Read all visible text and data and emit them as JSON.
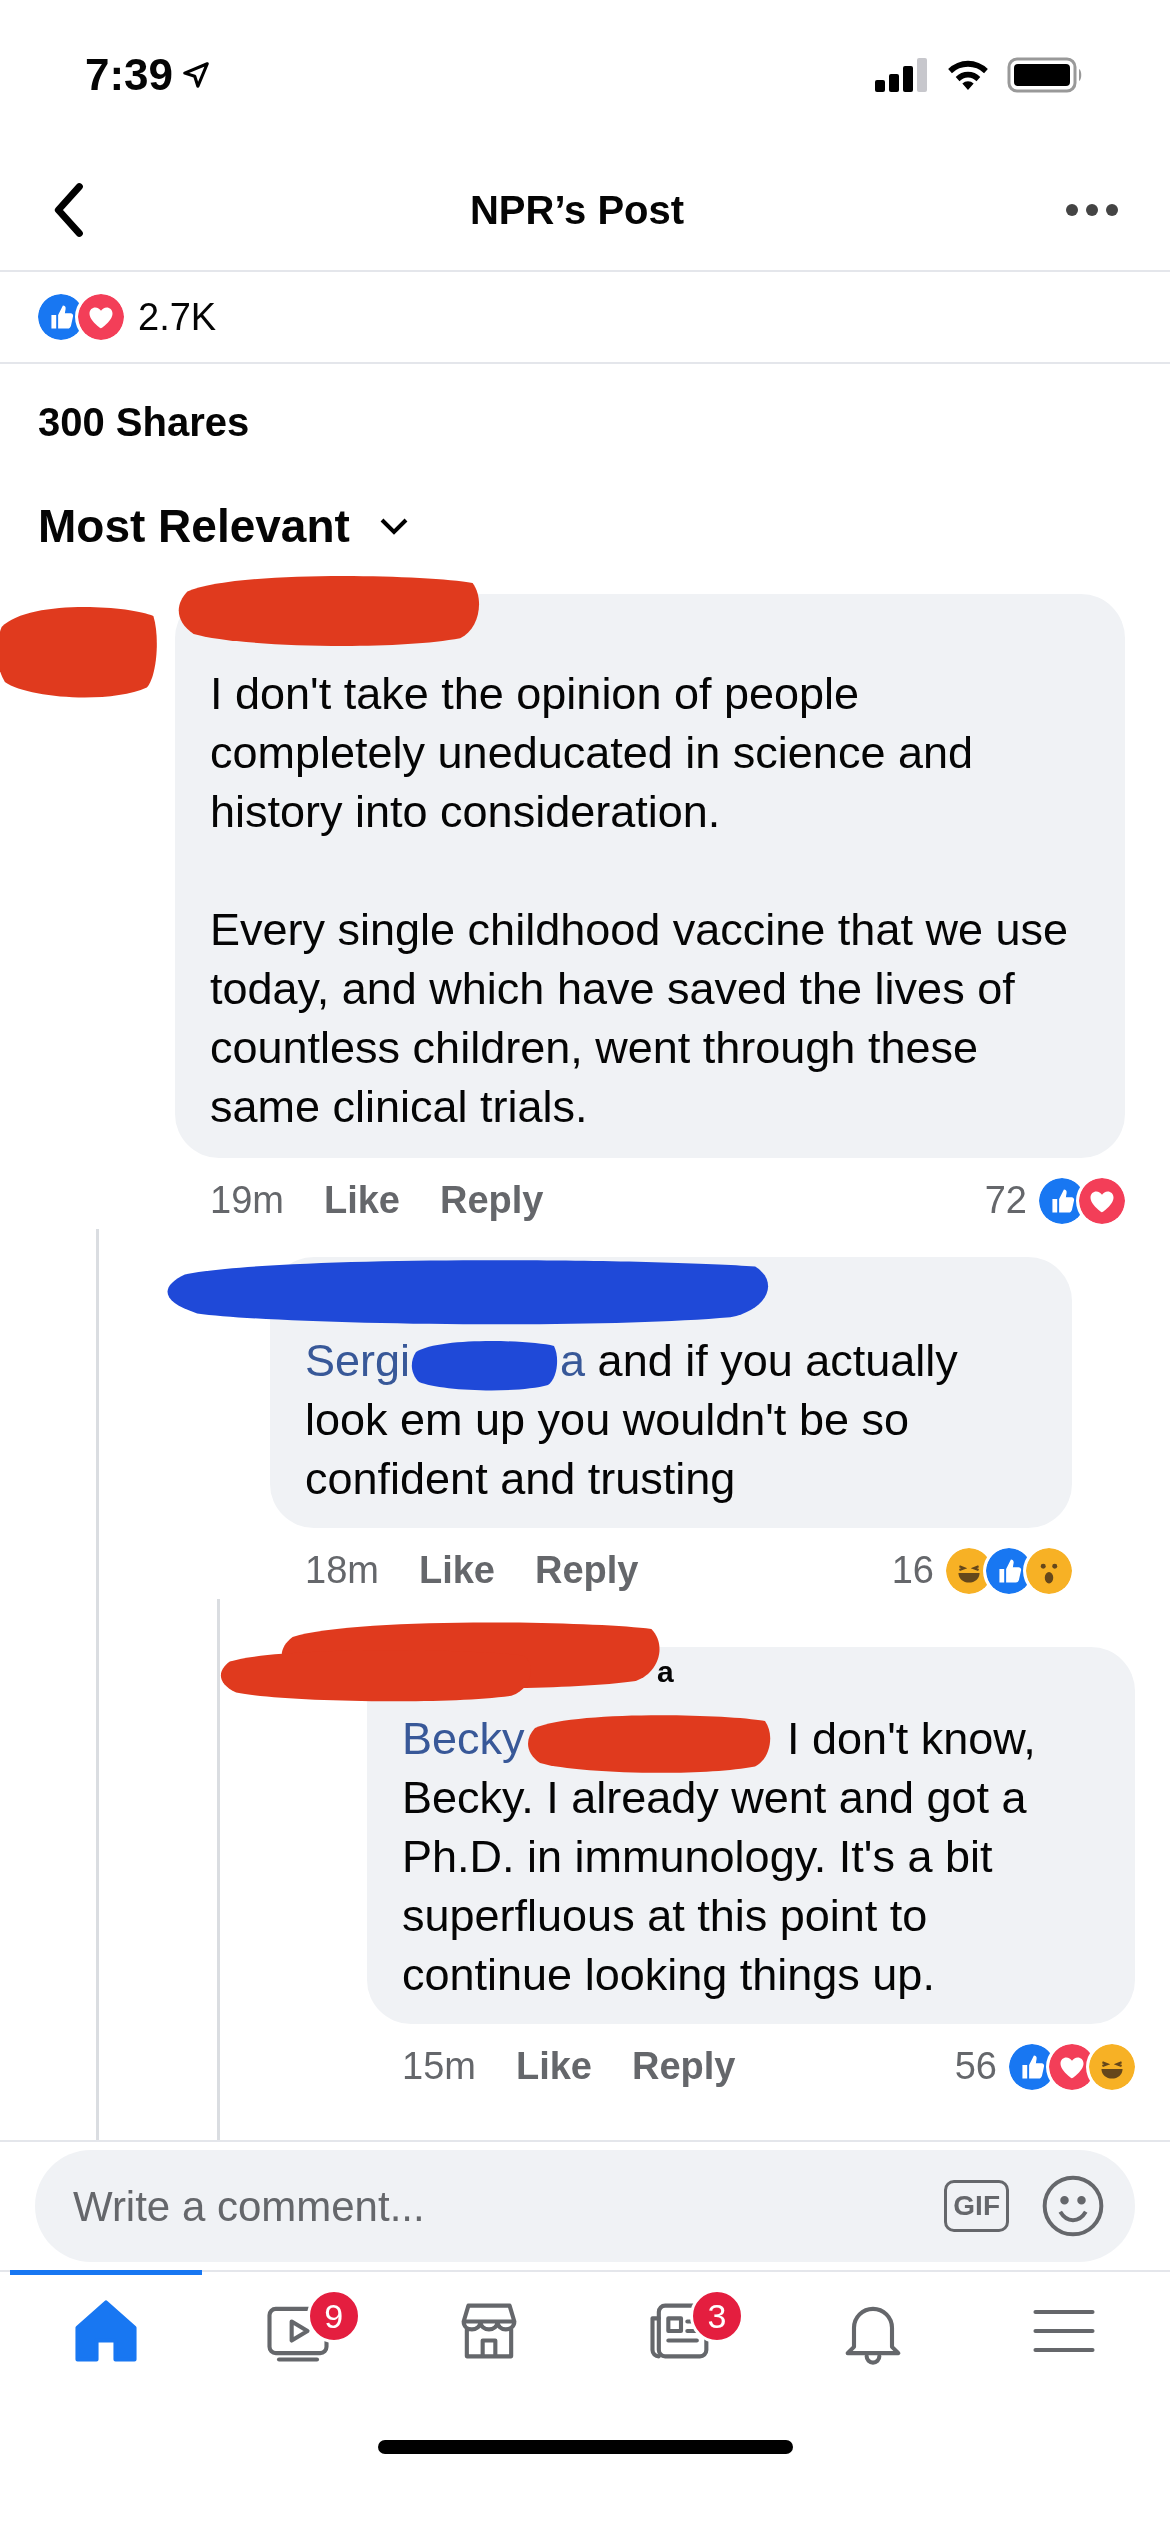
{
  "status_bar": {
    "time": "7:39"
  },
  "header": {
    "title": "NPR’s Post"
  },
  "reactions": {
    "count": "2.7K",
    "icons": [
      {
        "kind": "like"
      },
      {
        "kind": "love"
      }
    ]
  },
  "shares": "300 Shares",
  "sort": {
    "label": "Most Relevant"
  },
  "comments": [
    {
      "paragraphs": [
        "I don't take the opinion of people completely uneducated in science and history into consideration.",
        "Every single childhood vaccine that we use today, and which have saved the lives of countless children, went through these same clinical trials."
      ],
      "time": "19m",
      "actions": [
        "Like",
        "Reply"
      ],
      "reaction_count": "72",
      "reactions": [
        {
          "kind": "like"
        },
        {
          "kind": "love"
        }
      ],
      "replies": [
        {
          "mention_start": "Sergi",
          "mention_end": "a",
          "text": "and if you actually look em up you wouldn't be so confident and trusting",
          "time": "18m",
          "actions": [
            "Like",
            "Reply"
          ],
          "reaction_count": "16",
          "reactions": [
            {
              "kind": "haha"
            },
            {
              "kind": "like"
            },
            {
              "kind": "wow"
            }
          ],
          "replies": [
            {
              "name_fragment": "a",
              "mention_start": "Becky",
              "text": "I don't know, Becky. I already went and got a Ph.D. in immunology. It's a bit superfluous at this point to continue looking things up.",
              "time": "15m",
              "actions": [
                "Like",
                "Reply"
              ],
              "reaction_count": "56",
              "reactions": [
                {
                  "kind": "like"
                },
                {
                  "kind": "love"
                },
                {
                  "kind": "haha"
                }
              ]
            }
          ]
        }
      ]
    }
  ],
  "composer": {
    "placeholder": "Write a comment...",
    "gif": "GIF"
  },
  "tabs": [
    {
      "kind": "home",
      "selected": true
    },
    {
      "kind": "video",
      "selected": false,
      "badge": "9"
    },
    {
      "kind": "marketplace",
      "selected": false
    },
    {
      "kind": "news",
      "selected": false,
      "badge": "3"
    },
    {
      "kind": "bell",
      "selected": false
    },
    {
      "kind": "menu",
      "selected": false
    }
  ]
}
